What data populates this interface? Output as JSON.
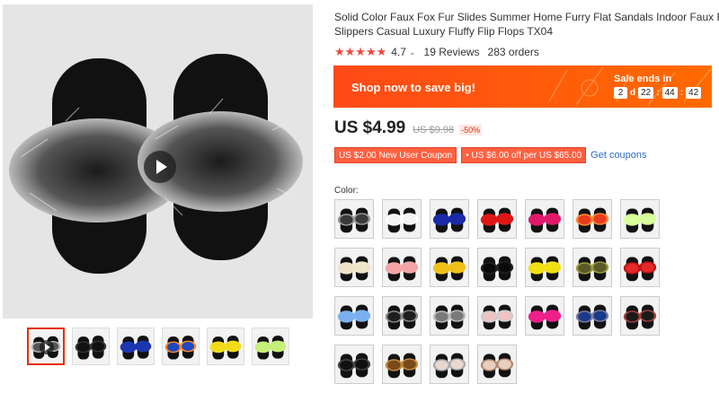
{
  "product": {
    "title_line1": "Solid Color Faux Fox Fur Slides Summer Home Furry Flat Sandals Indoor Faux Fox Fur",
    "title_line2": "Slippers Casual Luxury Fluffy Flip Flops TX04"
  },
  "rating": {
    "stars": "★★★★★",
    "value": "4.7",
    "reviews": "19 Reviews",
    "orders": "283 orders"
  },
  "banner": {
    "cta": "Shop now to save big!",
    "sale_ends": "Sale ends in",
    "days": "2",
    "days_unit": "d",
    "hours": "22",
    "minutes": "44",
    "seconds": "42",
    "colors": {
      "start": "#ff4a18",
      "end": "#ff6a00"
    }
  },
  "price": {
    "current": "US $4.99",
    "original": "US $9.98",
    "discount": "-50%"
  },
  "coupons": {
    "coupon1": "US $2.00 New User Coupon",
    "coupon2": "• US $6.00 off per US $65.00",
    "link": "Get coupons"
  },
  "color_label": "Color:",
  "main_image": {
    "fur_color": "#6a6a6a"
  },
  "thumbnails": [
    {
      "fur": "#555555",
      "tip": "#bbbbbb",
      "active": true
    },
    {
      "fur": "#111111",
      "tip": "#333333"
    },
    {
      "fur": "#1c36b0",
      "tip": "#1c36b0"
    },
    {
      "fur": "#2048c0",
      "tip": "#ff8a2a"
    },
    {
      "fur": "#f2dc1a",
      "tip": "#f2dc1a"
    },
    {
      "fur": "#c6f07a",
      "tip": "#c6f07a"
    }
  ],
  "swatches": [
    {
      "fur": "#3a3a3a",
      "tip": "#999999"
    },
    {
      "fur": "#f4f4f4",
      "tip": "#ffffff"
    },
    {
      "fur": "#1a2aa8",
      "tip": "#1a2aa8"
    },
    {
      "fur": "#e01616",
      "tip": "#e01616"
    },
    {
      "fur": "#e0196a",
      "tip": "#e0196a"
    },
    {
      "fur": "#ea3b20",
      "tip": "#ff8a30"
    },
    {
      "fur": "#d8ff9a",
      "tip": "#d8ff9a"
    },
    {
      "fur": "#efe3c8",
      "tip": "#efe3c8"
    },
    {
      "fur": "#f3a5a5",
      "tip": "#f3a5a5"
    },
    {
      "fur": "#f0c018",
      "tip": "#f0c018"
    },
    {
      "fur": "#0a0a0a",
      "tip": "#222222"
    },
    {
      "fur": "#f0e014",
      "tip": "#f0e014"
    },
    {
      "fur": "#5a5a28",
      "tip": "#9a9a40"
    },
    {
      "fur": "#e42a2a",
      "tip": "#c01010"
    },
    {
      "fur": "#7ab0f0",
      "tip": "#7ab0f0"
    },
    {
      "fur": "#1e1e1e",
      "tip": "#888888"
    },
    {
      "fur": "#7a7a7a",
      "tip": "#bbbbbb"
    },
    {
      "fur": "#f0c4c4",
      "tip": "#cccccc"
    },
    {
      "fur": "#f0208a",
      "tip": "#f0208a"
    },
    {
      "fur": "#1a3a8a",
      "tip": "#7a7aa0"
    },
    {
      "fur": "#1a1a1a",
      "tip": "#a04040"
    },
    {
      "fur": "#111111",
      "tip": "#444444"
    },
    {
      "fur": "#7a4a18",
      "tip": "#c08a40"
    },
    {
      "fur": "#e8d8d0",
      "tip": "#aaaaaa"
    },
    {
      "fur": "#e8cfc0",
      "tip": "#b08a70"
    }
  ]
}
